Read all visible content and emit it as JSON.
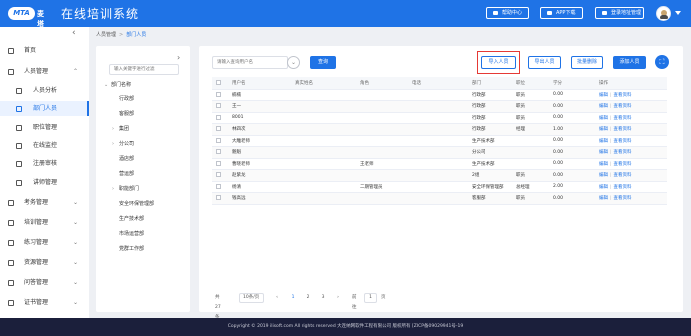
{
  "app": {
    "logo_mark": "MTA",
    "logo_text": "麦塔",
    "title": "在线培训系统",
    "buttons": [
      "帮助中心",
      "APP下载",
      "登录地址管理"
    ]
  },
  "sidebar": {
    "items": [
      {
        "label": "首页",
        "icon": "home-icon",
        "level": 0
      },
      {
        "label": "人员管理",
        "icon": "user-icon",
        "level": 0,
        "arrow": "⌃"
      },
      {
        "label": "人员分析",
        "icon": "chart-icon",
        "level": 1
      },
      {
        "label": "部门人员",
        "icon": "users-icon",
        "level": 1,
        "active": true
      },
      {
        "label": "职位管理",
        "icon": "position-icon",
        "level": 1
      },
      {
        "label": "在线监控",
        "icon": "monitor-icon",
        "level": 1
      },
      {
        "label": "注册审核",
        "icon": "audit-icon",
        "level": 1
      },
      {
        "label": "讲师管理",
        "icon": "teacher-icon",
        "level": 1
      },
      {
        "label": "考务管理",
        "icon": "exam-icon",
        "level": 0,
        "arrow": "⌄"
      },
      {
        "label": "培训管理",
        "icon": "training-icon",
        "level": 0,
        "arrow": "⌄"
      },
      {
        "label": "练习管理",
        "icon": "practice-icon",
        "level": 0,
        "arrow": "⌄"
      },
      {
        "label": "资源管理",
        "icon": "resource-icon",
        "level": 0,
        "arrow": "⌄"
      },
      {
        "label": "问答管理",
        "icon": "qa-icon",
        "level": 0,
        "arrow": "⌄"
      },
      {
        "label": "证书管理",
        "icon": "certificate-icon",
        "level": 0,
        "arrow": "⌄"
      }
    ]
  },
  "breadcrumb": {
    "parent": "人员管理",
    "separator": ">",
    "current": "部门人员"
  },
  "tree": {
    "placeholder": "输入关键字进行过滤",
    "nodes": [
      {
        "label": "部门名称",
        "toggle": "⌄",
        "indent": 0
      },
      {
        "label": "行政部",
        "toggle": "",
        "indent": 1
      },
      {
        "label": "客服部",
        "toggle": "",
        "indent": 1
      },
      {
        "label": "集团",
        "toggle": "›",
        "indent": 1
      },
      {
        "label": "分公司",
        "toggle": "›",
        "indent": 1
      },
      {
        "label": "酒店部",
        "toggle": "",
        "indent": 1
      },
      {
        "label": "营运部",
        "toggle": "",
        "indent": 1
      },
      {
        "label": "职能部门",
        "toggle": "›",
        "indent": 1
      },
      {
        "label": "安全环保管理部",
        "toggle": "",
        "indent": 1
      },
      {
        "label": "生产技术部",
        "toggle": "",
        "indent": 1
      },
      {
        "label": "市场运营部",
        "toggle": "",
        "indent": 1
      },
      {
        "label": "党群工作部",
        "toggle": "",
        "indent": 1
      }
    ]
  },
  "toolbar": {
    "search_placeholder": "请输入查询用户名",
    "filter_glyph": "⌄",
    "query": "查询",
    "import": "导入人员",
    "export": "导出人员",
    "batch_delete": "批量删除",
    "add": "添加人员",
    "fullscreen_glyph": "⛶"
  },
  "table": {
    "columns": [
      "用户名",
      "真实姓名",
      "角色",
      "电话",
      "部门",
      "职位",
      "学分",
      "操作"
    ],
    "rows": [
      {
        "username": "楠楠",
        "realname": "",
        "role": "",
        "phone": "",
        "dept": "行政部",
        "position": "职员",
        "credit": "0.00"
      },
      {
        "username": "王一",
        "realname": "",
        "role": "",
        "phone": "",
        "dept": "行政部",
        "position": "职员",
        "credit": "0.00"
      },
      {
        "username": "8001",
        "realname": "",
        "role": "",
        "phone": "",
        "dept": "行政部",
        "position": "职员",
        "credit": "0.00"
      },
      {
        "username": "林四次",
        "realname": "",
        "role": "",
        "phone": "",
        "dept": "行政部",
        "position": "经理",
        "credit": "1.00"
      },
      {
        "username": "大雕老师",
        "realname": "",
        "role": "",
        "phone": "",
        "dept": "生产技术部",
        "position": "",
        "credit": "0.00"
      },
      {
        "username": "魁魁",
        "realname": "",
        "role": "",
        "phone": "",
        "dept": "分公司",
        "position": "",
        "credit": "0.00"
      },
      {
        "username": "曹晓老师",
        "realname": "",
        "role": "王老师",
        "phone": "",
        "dept": "生产技术部",
        "position": "",
        "credit": "0.00"
      },
      {
        "username": "赵紫龙",
        "realname": "",
        "role": "",
        "phone": "",
        "dept": "2组",
        "position": "职员",
        "credit": "0.00"
      },
      {
        "username": "杨清",
        "realname": "",
        "role": "二期管理员",
        "phone": "",
        "dept": "安全环保管理部",
        "position": "总经理",
        "credit": "2.00"
      },
      {
        "username": "钱高远",
        "realname": "",
        "role": "",
        "phone": "",
        "dept": "客服部",
        "position": "职员",
        "credit": "0.00"
      }
    ],
    "action_edit": "编辑",
    "action_sep": "|",
    "action_view": "查看资料"
  },
  "pager": {
    "total": "共 27 条",
    "page_size": "10条/页",
    "prev": "‹",
    "pages": [
      "1",
      "2",
      "3"
    ],
    "next": "›",
    "goto_label": "前往",
    "goto_value": "1",
    "goto_unit": "页"
  },
  "footer": {
    "text": "Copyright © 2019 ilisoft.com All rights reserved 大连纳网软件工程有限公司 版权所有 [ZICP备09029941号-19"
  },
  "colors": {
    "primary": "#1f73e6",
    "highlight": "#e53935",
    "footer_bg": "#1b1f3b"
  }
}
